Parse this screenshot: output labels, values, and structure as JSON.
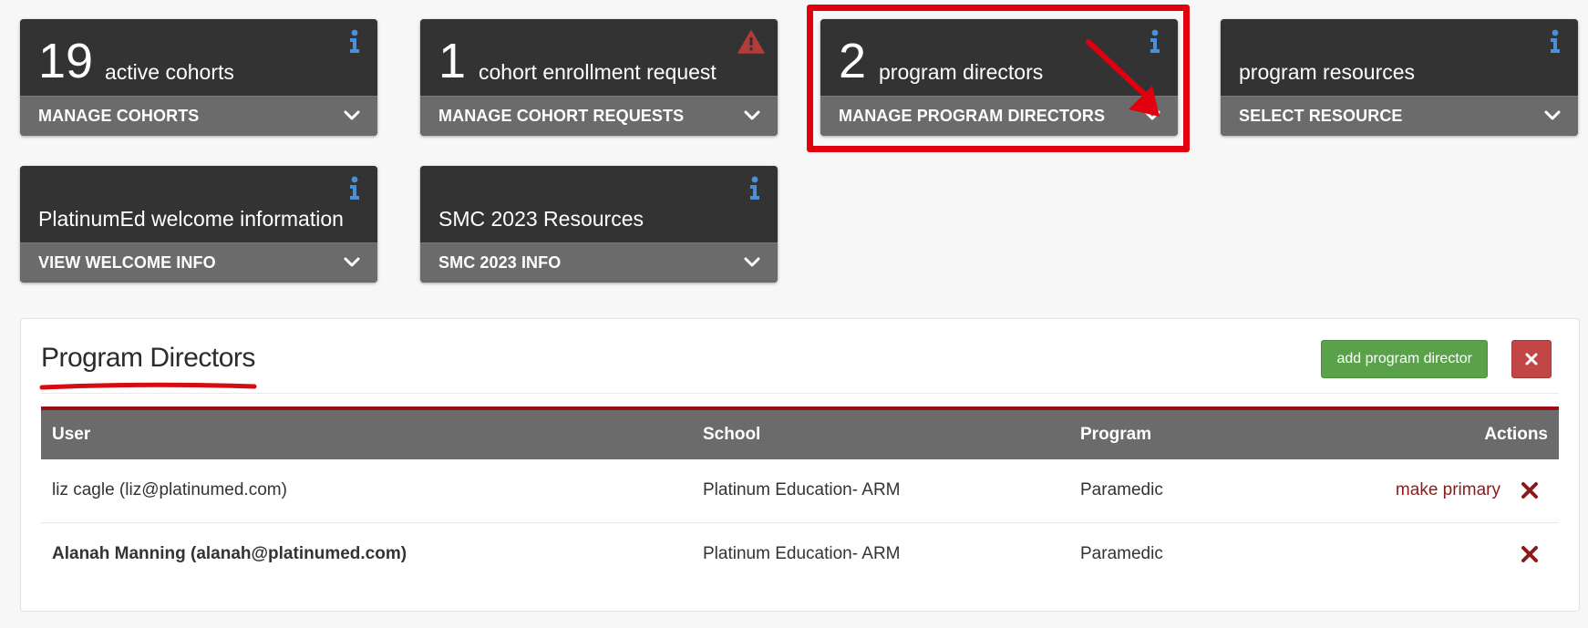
{
  "colors": {
    "card_top": "#333333",
    "card_bottom": "#6b6b6b",
    "info_icon": "#4a90d9",
    "warning_icon": "#b23b3b",
    "highlight": "#e0000f",
    "header_accent": "#9b1111",
    "add_button": "#5aa24a",
    "close_button": "#c24646",
    "action_link": "#8b1a1a"
  },
  "cards": [
    {
      "count": "19",
      "label": "active cohorts",
      "action": "MANAGE COHORTS",
      "icon": "info-icon"
    },
    {
      "count": "1",
      "label": "cohort enrollment request",
      "action": "MANAGE COHORT REQUESTS",
      "icon": "warning-icon"
    },
    {
      "count": "2",
      "label": "program directors",
      "action": "MANAGE PROGRAM DIRECTORS",
      "icon": "info-icon"
    },
    {
      "count": "",
      "label": "program resources",
      "action": "SELECT RESOURCE",
      "icon": "info-icon"
    },
    {
      "count": "",
      "label": "PlatinumEd welcome information",
      "action": "VIEW WELCOME INFO",
      "icon": "info-icon"
    },
    {
      "count": "",
      "label": "SMC 2023 Resources",
      "action": "SMC 2023 INFO",
      "icon": "info-icon"
    }
  ],
  "panel": {
    "title": "Program Directors",
    "add_button": "add program director",
    "close_icon": "close-icon",
    "columns": [
      "User",
      "School",
      "Program",
      "Actions"
    ],
    "rows": [
      {
        "user": "liz cagle (liz@platinumed.com)",
        "school": "Platinum Education- ARM",
        "program": "Paramedic",
        "action_link": "make primary",
        "primary": false
      },
      {
        "user": "Alanah Manning (alanah@platinumed.com)",
        "school": "Platinum Education- ARM",
        "program": "Paramedic",
        "action_link": "",
        "primary": true
      }
    ]
  }
}
